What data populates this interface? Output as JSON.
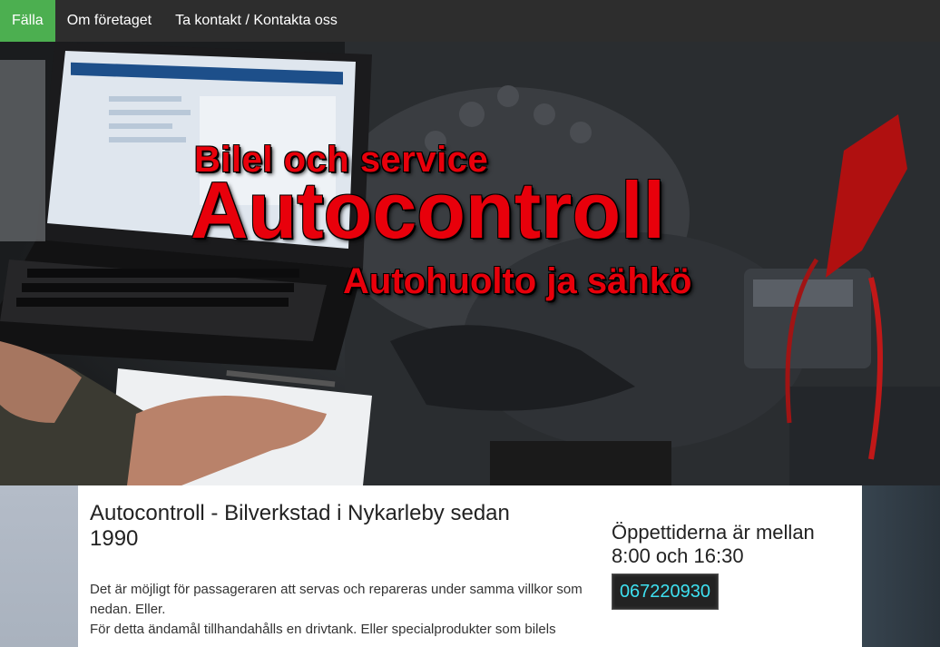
{
  "nav": {
    "items": [
      {
        "label": "Fälla",
        "active": true
      },
      {
        "label": "Om företaget",
        "active": false
      },
      {
        "label": "Ta kontakt / Kontakta oss",
        "active": false
      }
    ],
    "active_color": "#4caf50"
  },
  "hero": {
    "line1": "Bilel och service",
    "line2": "Autocontroll",
    "line3": "Autohuolto ja sähkö",
    "text_color": "#e8000b"
  },
  "main": {
    "title": "Autocontroll - Bilverkstad i Nykarleby sedan 1990",
    "paragraphs": [
      "Det är möjligt för passageraren att servas och repareras under samma villkor som nedan. Eller.",
      "För detta ändamål tillhandahålls en drivtank. Eller specialprodukter som bilels"
    ]
  },
  "sidebar": {
    "hours": "Öppettiderna är mellan 8:00 och 16:30",
    "phone": "067220930",
    "phone_color": "#3ee0f0"
  }
}
